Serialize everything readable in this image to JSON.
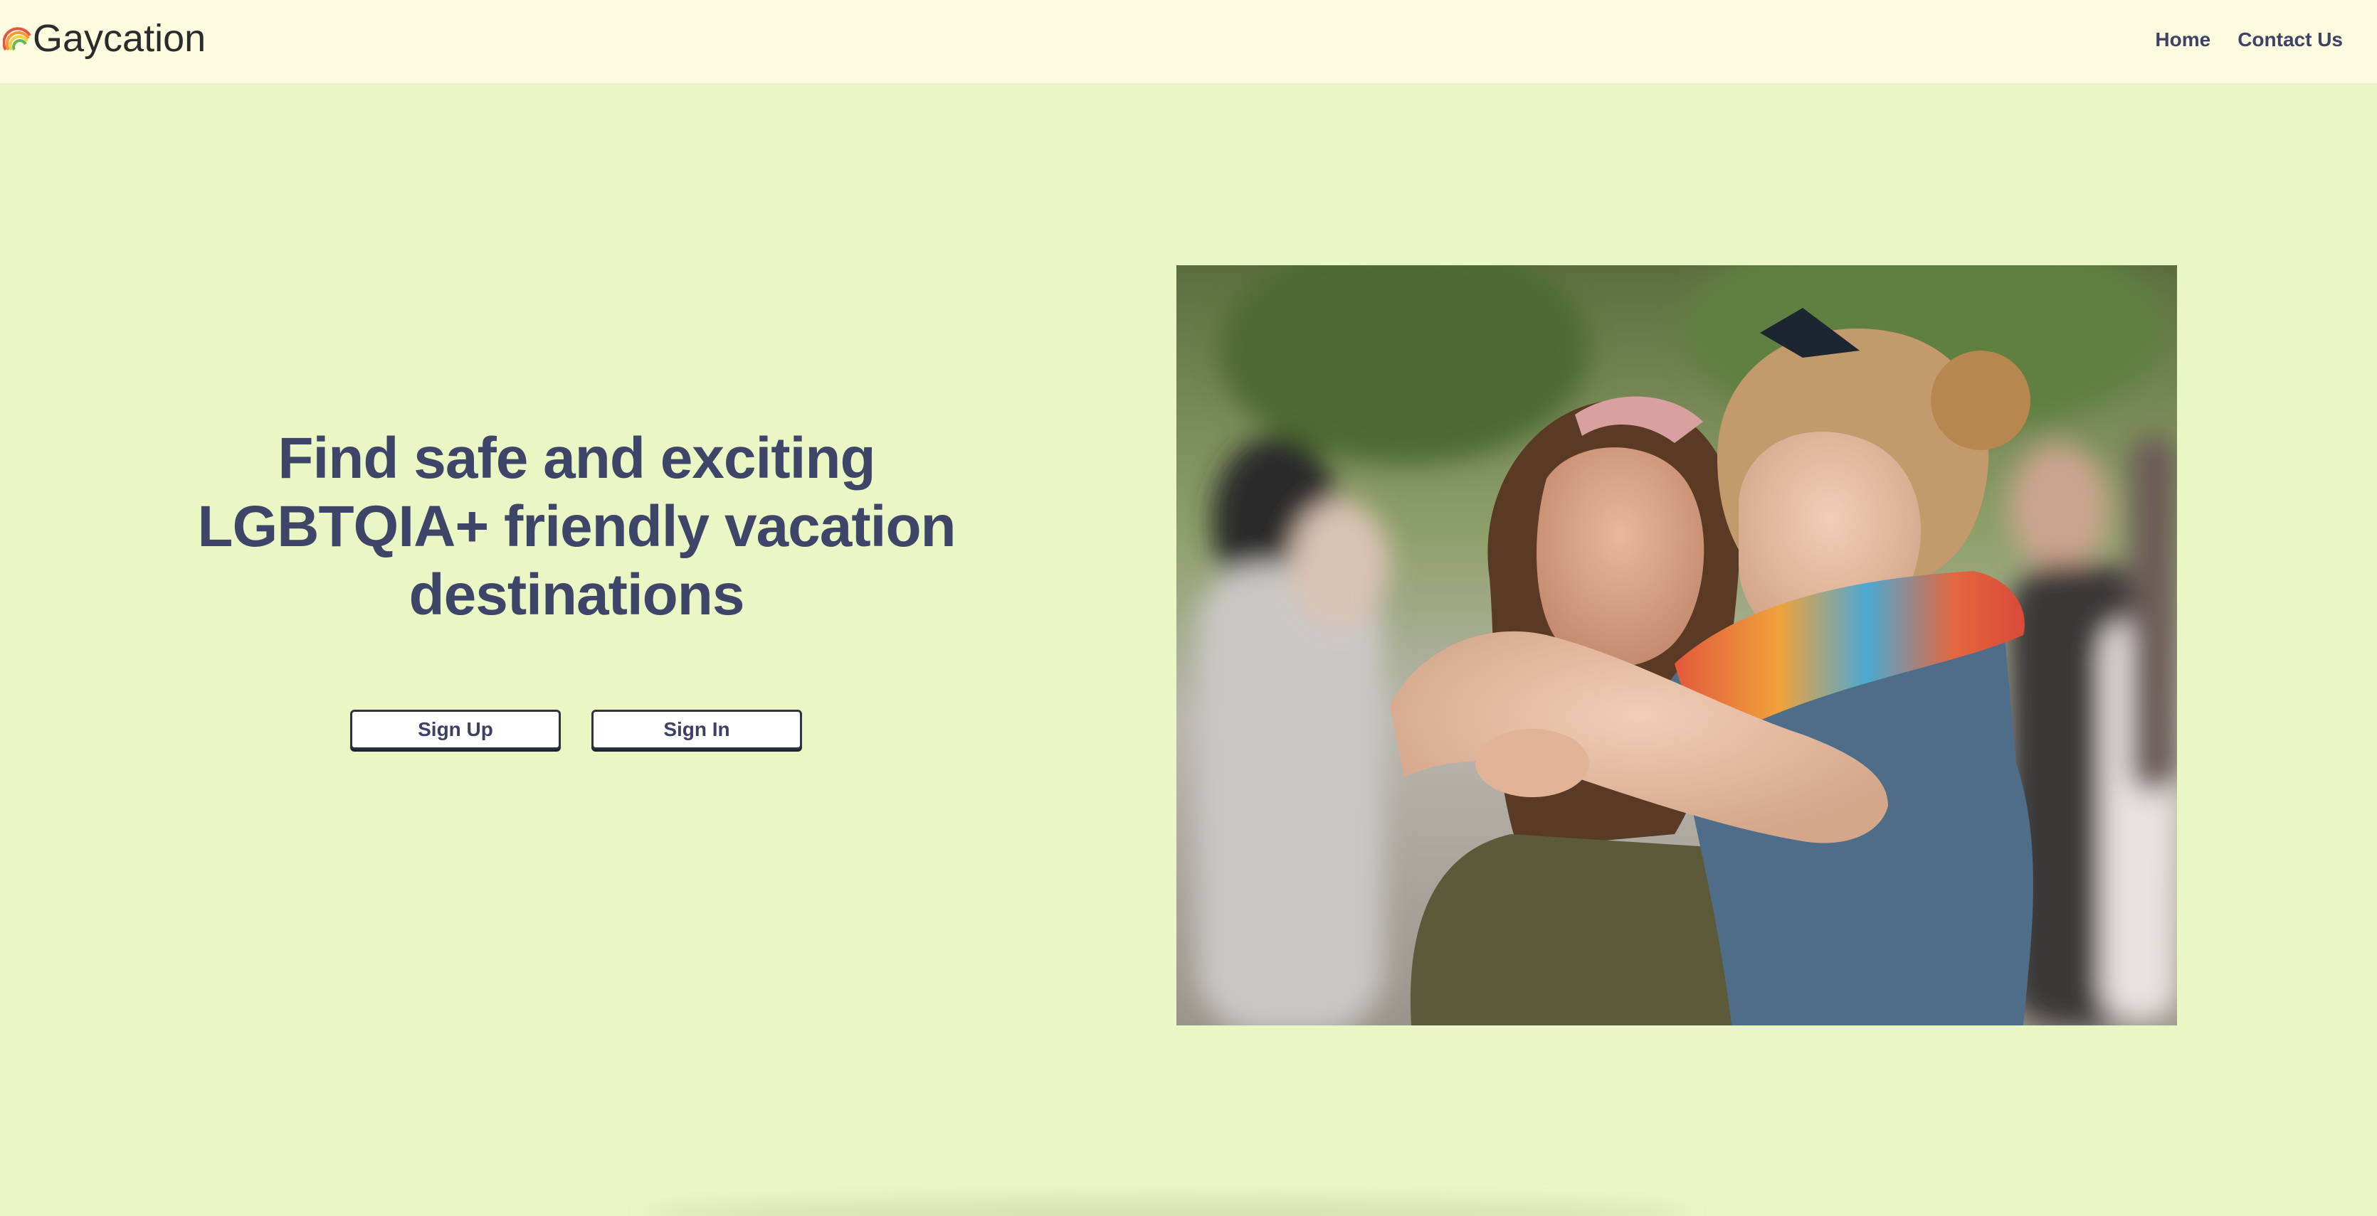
{
  "header": {
    "brand": {
      "icon": "rainbow-icon",
      "name": "Gaycation"
    },
    "nav": [
      {
        "label": "Home"
      },
      {
        "label": "Contact Us"
      }
    ]
  },
  "hero": {
    "headline": "Find safe and exciting LGBTQIA+ friendly vacation destinations",
    "buttons": {
      "sign_up": "Sign Up",
      "sign_in": "Sign In"
    },
    "photo": {
      "subject": "two people embracing, one wearing a rainbow scarf"
    }
  },
  "colors": {
    "header_bg": "#fdfce1",
    "page_bg": "#eaf7c5",
    "headline": "#3f4569",
    "nav_text": "#3e4266",
    "brand_text": "#2a2b2b"
  }
}
